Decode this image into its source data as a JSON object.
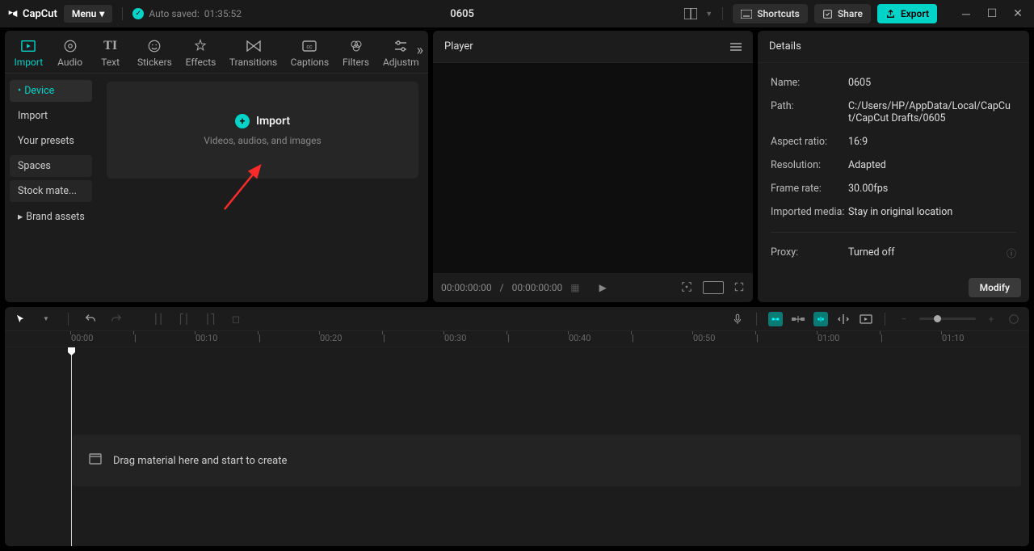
{
  "app": {
    "name": "CapCut",
    "menu": "Menu"
  },
  "autosave": {
    "label": "Auto saved:",
    "time": "01:35:52"
  },
  "project_title": "0605",
  "topbar": {
    "shortcuts": "Shortcuts",
    "share": "Share",
    "export": "Export"
  },
  "tabs": [
    {
      "label": "Import"
    },
    {
      "label": "Audio"
    },
    {
      "label": "Text"
    },
    {
      "label": "Stickers"
    },
    {
      "label": "Effects"
    },
    {
      "label": "Transitions"
    },
    {
      "label": "Captions"
    },
    {
      "label": "Filters"
    },
    {
      "label": "Adjustm"
    }
  ],
  "sidebar": {
    "items": [
      {
        "label": "Device",
        "bullet": "•"
      },
      {
        "label": "Import"
      },
      {
        "label": "Your presets"
      },
      {
        "label": "Spaces"
      },
      {
        "label": "Stock mate..."
      },
      {
        "label": "Brand assets",
        "chev": "▸"
      }
    ]
  },
  "import_card": {
    "title": "Import",
    "subtitle": "Videos, audios, and images"
  },
  "player": {
    "title": "Player",
    "time_current": "00:00:00:00",
    "time_total": "00:00:00:00"
  },
  "details": {
    "title": "Details",
    "rows": [
      {
        "label": "Name:",
        "value": "0605"
      },
      {
        "label": "Path:",
        "value": "C:/Users/HP/AppData/Local/CapCut/CapCut Drafts/0605"
      },
      {
        "label": "Aspect ratio:",
        "value": "16:9"
      },
      {
        "label": "Resolution:",
        "value": "Adapted"
      },
      {
        "label": "Frame rate:",
        "value": "30.00fps"
      },
      {
        "label": "Imported media:",
        "value": "Stay in original location"
      }
    ],
    "proxy": {
      "label": "Proxy:",
      "value": "Turned off"
    },
    "modify": "Modify"
  },
  "timeline": {
    "ticks": [
      "00:00",
      "|",
      "00:10",
      "|",
      "00:20",
      "|",
      "00:30",
      "|",
      "00:40",
      "|",
      "00:50",
      "|",
      "01:00",
      "|",
      "01:10"
    ],
    "drop_hint": "Drag material here and start to create"
  }
}
